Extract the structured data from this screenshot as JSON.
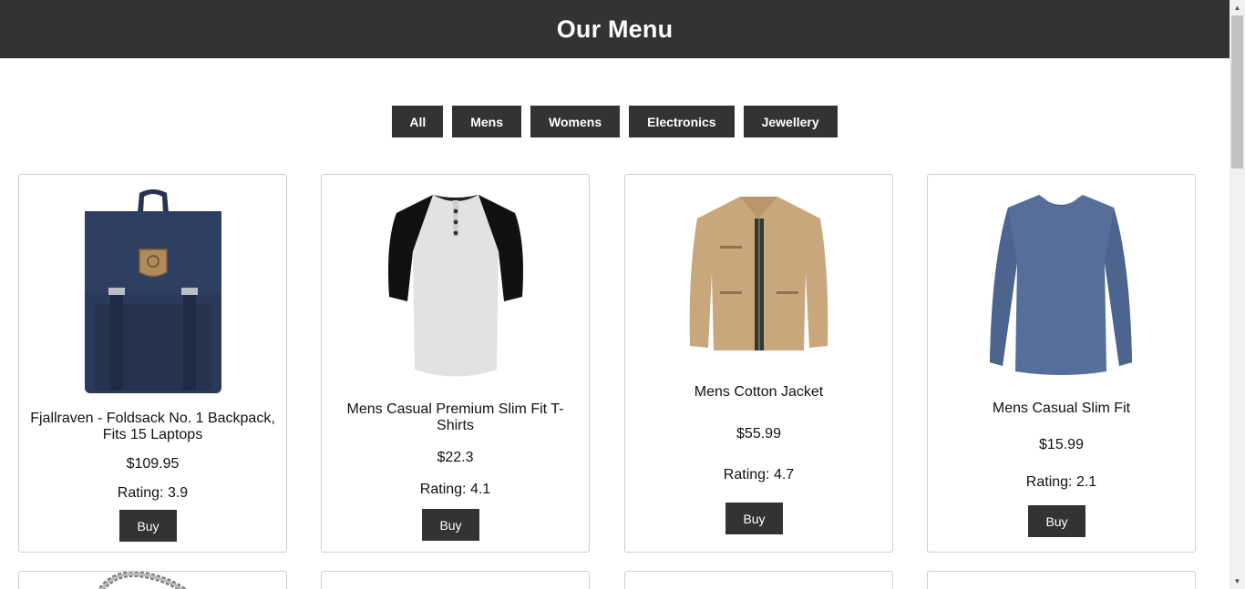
{
  "header": {
    "title": "Our Menu"
  },
  "filters": [
    "All",
    "Mens",
    "Womens",
    "Electronics",
    "Jewellery"
  ],
  "products": [
    {
      "title": "Fjallraven - Foldsack No. 1 Backpack, Fits 15 Laptops",
      "price": "$109.95",
      "rating": "Rating: 3.9",
      "buy": "Buy",
      "image": "backpack-image"
    },
    {
      "title": "Mens Casual Premium Slim Fit T-Shirts",
      "price": "$22.3",
      "rating": "Rating: 4.1",
      "buy": "Buy",
      "image": "tshirt-image"
    },
    {
      "title": "Mens Cotton Jacket",
      "price": "$55.99",
      "rating": "Rating: 4.7",
      "buy": "Buy",
      "image": "jacket-image"
    },
    {
      "title": "Mens Casual Slim Fit",
      "price": "$15.99",
      "rating": "Rating: 2.1",
      "buy": "Buy",
      "image": "longsleeve-image"
    }
  ],
  "colors": {
    "header_bg": "#333333",
    "button_bg": "#333333",
    "card_border": "#cfcfcf"
  }
}
